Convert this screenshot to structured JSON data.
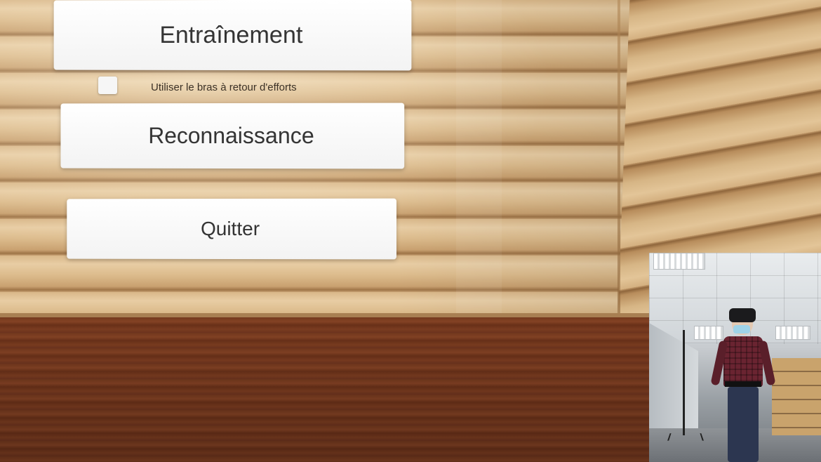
{
  "menu": {
    "training_label": "Entraînement",
    "force_feedback_label": "Utiliser le bras à retour d'efforts",
    "force_feedback_checked": false,
    "recognition_label": "Reconnaissance",
    "quit_label": "Quitter"
  },
  "colors": {
    "button_bg": "#f5f5f5",
    "button_text": "#333333",
    "wall_wood": "#dcbb8c",
    "floor_wood": "#7a3b1f"
  },
  "camera_feed": {
    "icon": "person-with-vr-headset-icon"
  }
}
